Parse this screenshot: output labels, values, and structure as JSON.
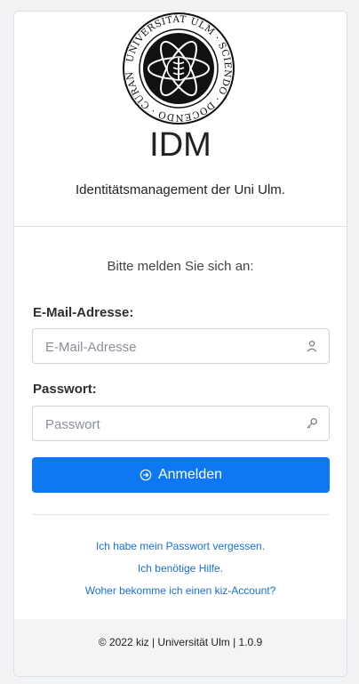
{
  "logo": {
    "seal_text": "UNIVERSITÄT ULM · SCIENDO · DOCENDO · CURANDO ·"
  },
  "header": {
    "title": "IDM",
    "subtitle": "Identitätsmanagement der Uni Ulm."
  },
  "login": {
    "prompt": "Bitte melden Sie sich an:",
    "email_label": "E-Mail-Adresse:",
    "email_placeholder": "E-Mail-Adresse",
    "password_label": "Passwort:",
    "password_placeholder": "Passwort",
    "submit_label": "Anmelden",
    "submit_icon": "arrow-right-circle-icon",
    "email_icon": "user-icon",
    "password_icon": "key-icon"
  },
  "links": {
    "forgot": "Ich habe mein Passwort vergessen.",
    "help": "Ich benötige Hilfe.",
    "account": "Woher bekomme ich einen kiz-Account?"
  },
  "footer": {
    "text": "© 2022 kiz | Universität Ulm | 1.0.9"
  },
  "colors": {
    "accent": "#0d78f2",
    "link": "#1a6fd6",
    "background": "#f1f2f4"
  }
}
